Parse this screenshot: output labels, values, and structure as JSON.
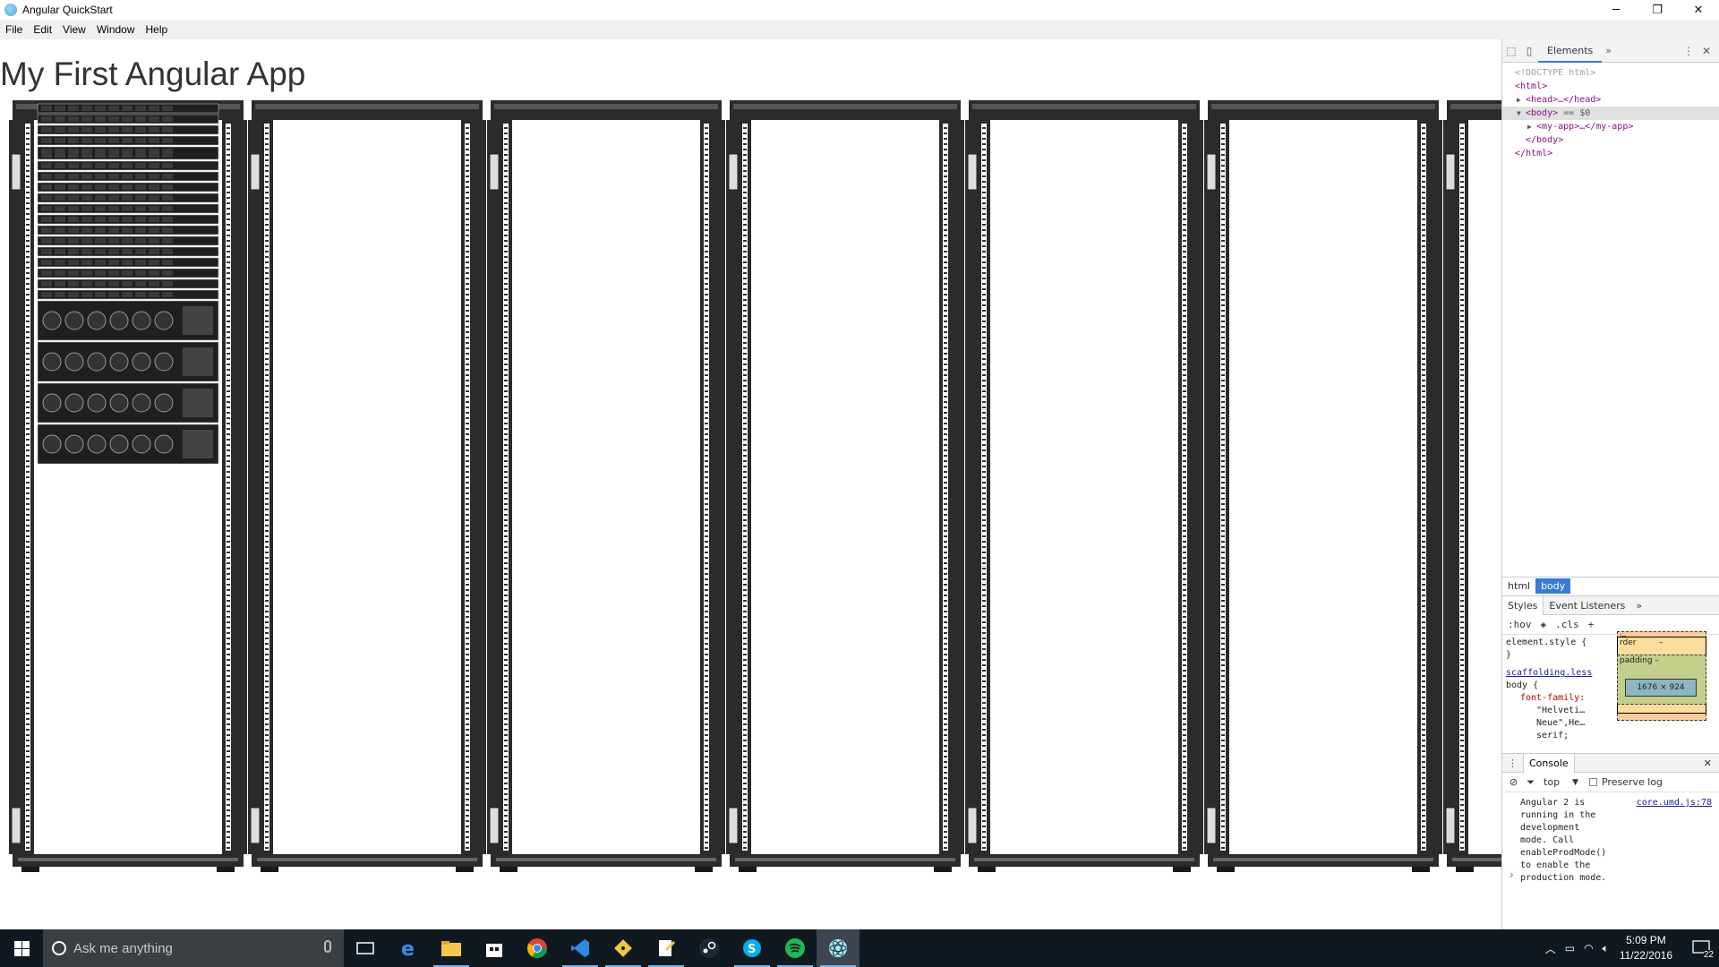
{
  "window": {
    "title": "Angular QuickStart",
    "minimize": "─",
    "restore": "❐",
    "close": "✕"
  },
  "menu": [
    "File",
    "Edit",
    "View",
    "Window",
    "Help"
  ],
  "app": {
    "heading": "My First Angular App",
    "rack_count": 7,
    "first_rack_units": [
      "1u",
      "1u",
      "1u",
      "1u",
      "2u",
      "1u",
      "1u",
      "1u",
      "1u",
      "1u",
      "1u",
      "1u",
      "1u",
      "1u",
      "1u",
      "1u",
      "1u",
      "1u",
      "2u-fan",
      "2u-fan",
      "2u-fan",
      "2u-fan"
    ]
  },
  "devtools": {
    "tab_elements": "Elements",
    "more": "»",
    "dom": [
      {
        "text": "<!DOCTYPE html>",
        "kind": "comment",
        "indent": 0
      },
      {
        "text": "<html>",
        "kind": "tag",
        "indent": 0
      },
      {
        "text": "<head>…</head>",
        "kind": "tag",
        "indent": 1,
        "tri": "▶"
      },
      {
        "text": "<body>",
        "kind": "tag",
        "indent": 1,
        "tri": "▼",
        "suffix": " == $0",
        "selected": true
      },
      {
        "text": "<my-app>…</my-app>",
        "kind": "tag",
        "indent": 2,
        "tri": "▶"
      },
      {
        "text": "</body>",
        "kind": "tag",
        "indent": 1
      },
      {
        "text": "</html>",
        "kind": "tag",
        "indent": 0
      }
    ],
    "crumbs": [
      "html",
      "body"
    ],
    "styles_tabs": [
      "Styles",
      "Event Listeners"
    ],
    "filter": {
      "hov": ":hov",
      "cls": ".cls",
      "add": "+"
    },
    "rules": {
      "element_style": "element.style {",
      "close": "}",
      "source": "scaffolding.less",
      "selector": "body {",
      "prop": "font-family:",
      "val1": "\"Helveti…",
      "val2": "Neue\",He…",
      "val3": "serif;"
    },
    "boxmodel": {
      "margin": "in",
      "border": "rder",
      "padding": "padding –",
      "dash": "–",
      "content": "1676 × 924"
    },
    "console": {
      "tab": "Console",
      "context": "top",
      "preserve": "Preserve log",
      "message": "Angular 2 is running in the development mode. Call enableProdMode() to enable the production mode.",
      "source": "core.umd.js:78",
      "prompt": "›"
    }
  },
  "taskbar": {
    "search_placeholder": "Ask me anything",
    "time": "5:09 PM",
    "date": "11/22/2016",
    "notifications": "22"
  }
}
